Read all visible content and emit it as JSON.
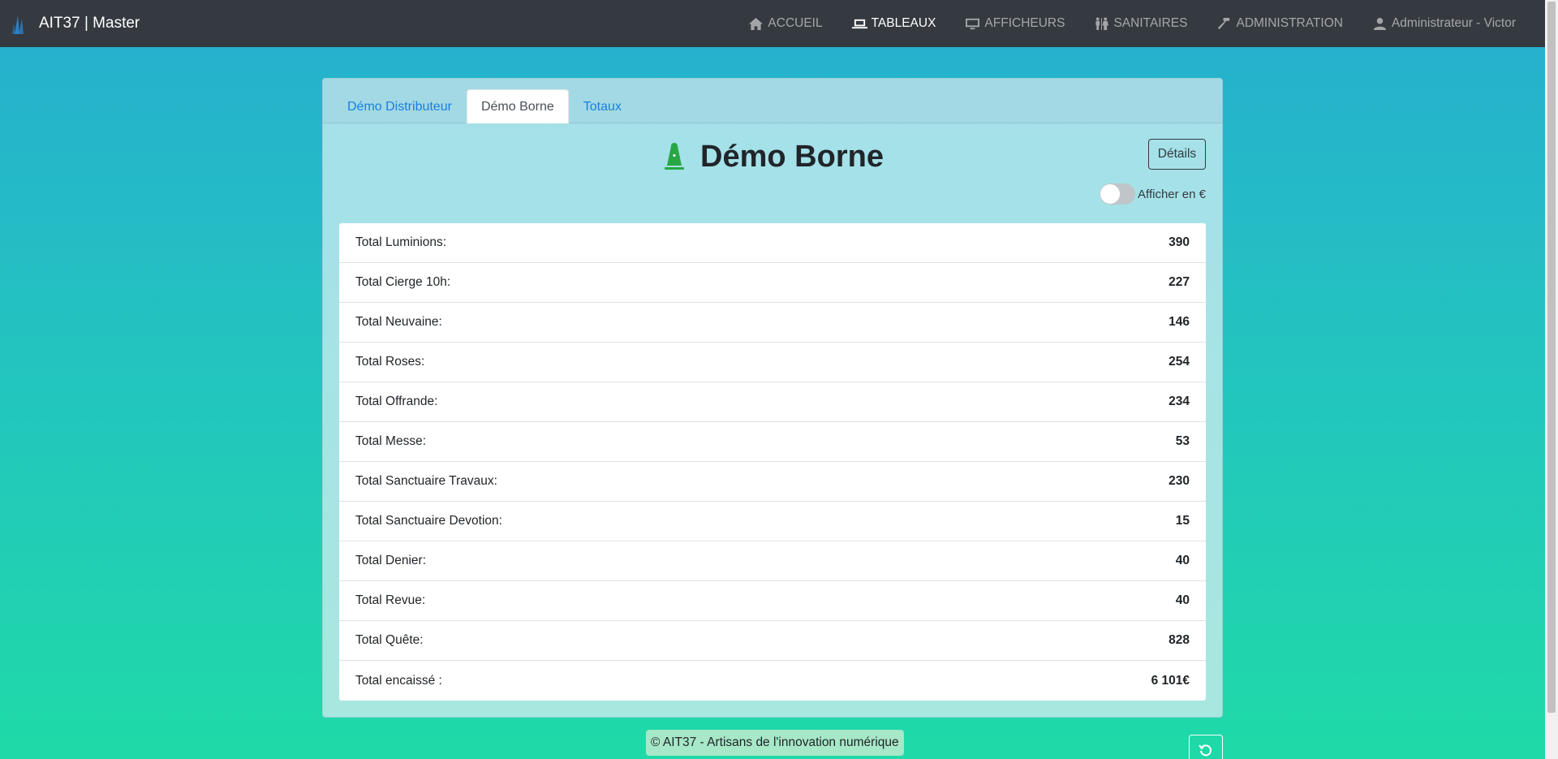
{
  "navbar": {
    "brand": "AIT37 | Master",
    "items": [
      {
        "label": "ACCUEIL",
        "icon": "home-icon",
        "active": false
      },
      {
        "label": "TABLEAUX",
        "icon": "laptop-icon",
        "active": true
      },
      {
        "label": "AFFICHEURS",
        "icon": "monitor-icon",
        "active": false
      },
      {
        "label": "SANITAIRES",
        "icon": "restroom-icon",
        "active": false
      },
      {
        "label": "ADMINISTRATION",
        "icon": "hammer-icon",
        "active": false
      },
      {
        "label": "Administrateur - Victor",
        "icon": "user-icon",
        "active": false
      }
    ]
  },
  "tabs": [
    "Démo Distributeur",
    "Démo Borne",
    "Totaux"
  ],
  "active_tab": "Démo Borne",
  "main": {
    "title": "Démo Borne",
    "icon": "bell-icon",
    "icon_color": "#28a745",
    "details_label": "Détails",
    "toggle_label": "Afficher en €",
    "toggle_on": false
  },
  "totals": [
    {
      "label": "Total Luminions:",
      "value": "390"
    },
    {
      "label": "Total Cierge 10h:",
      "value": "227"
    },
    {
      "label": "Total Neuvaine:",
      "value": "146"
    },
    {
      "label": "Total Roses:",
      "value": "254"
    },
    {
      "label": "Total Offrande:",
      "value": "234"
    },
    {
      "label": "Total Messe:",
      "value": "53"
    },
    {
      "label": "Total Sanctuaire Travaux:",
      "value": "230"
    },
    {
      "label": "Total Sanctuaire Devotion:",
      "value": "15"
    },
    {
      "label": "Total Denier:",
      "value": "40"
    },
    {
      "label": "Total Revue:",
      "value": "40"
    },
    {
      "label": "Total Quête:",
      "value": "828"
    },
    {
      "label": "Total encaissé :",
      "value": "6 101€"
    }
  ],
  "footer": "© AIT37 - Artisans de l'innovation numérique"
}
